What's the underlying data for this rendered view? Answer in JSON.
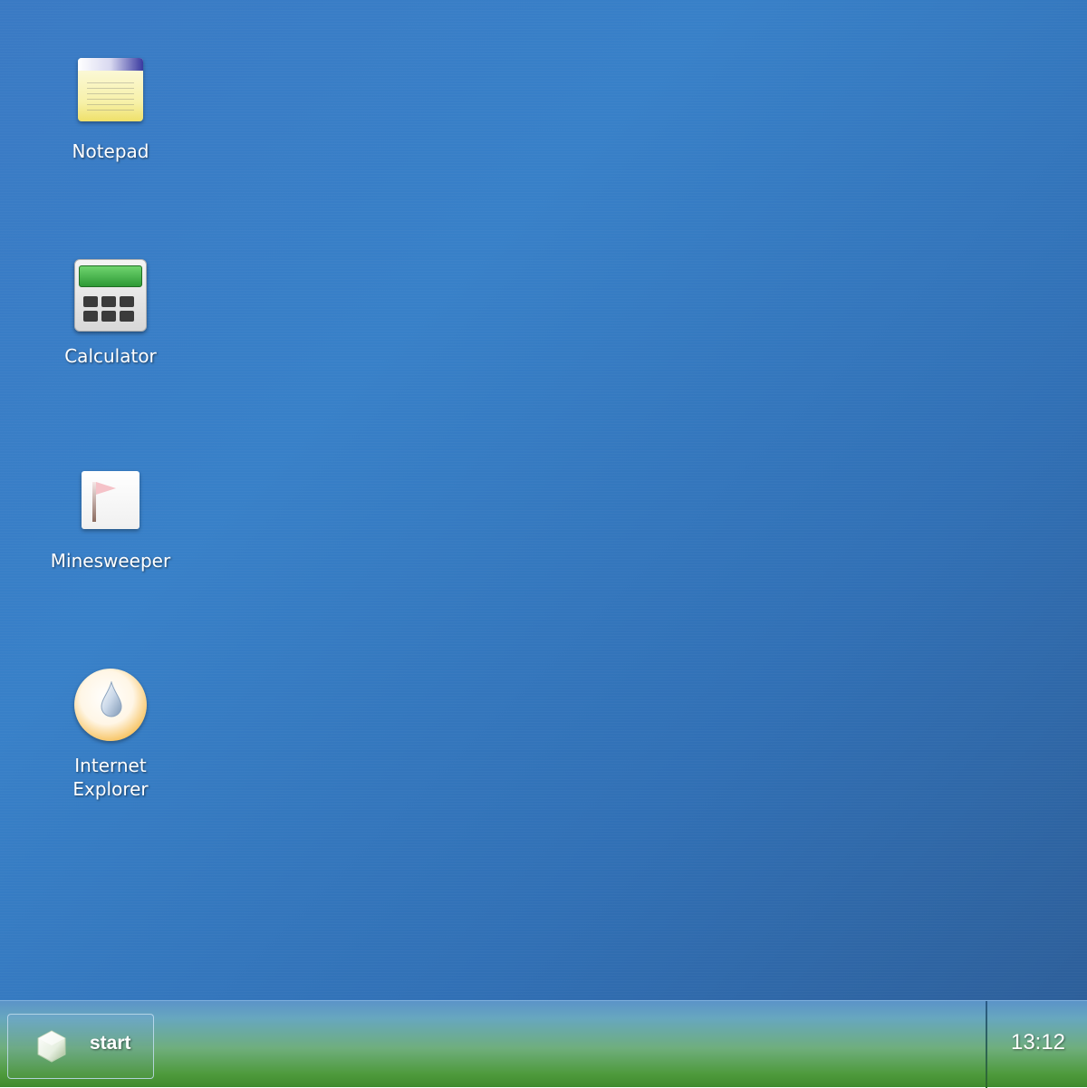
{
  "desktop": {
    "icons": [
      {
        "label": "Notepad",
        "icon": "notepad-icon"
      },
      {
        "label": "Calculator",
        "icon": "calculator-icon"
      },
      {
        "label": "Minesweeper",
        "icon": "minesweeper-icon"
      },
      {
        "label": "Internet\nExplorer",
        "icon": "internet-explorer-icon"
      }
    ]
  },
  "taskbar": {
    "start_label": "start",
    "start_icon": "start-logo-icon",
    "clock": "13:12"
  },
  "colors": {
    "desktop_blue": "#3880c8",
    "taskbar_green": "#4e9a3c",
    "calc_screen_green": "#2e9a35",
    "ie_orange": "#e99626"
  }
}
